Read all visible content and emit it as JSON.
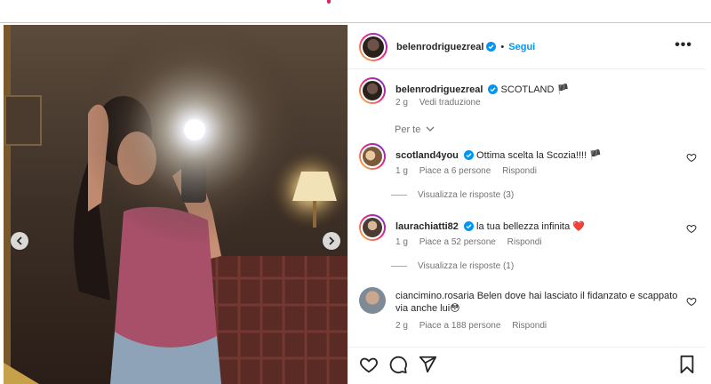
{
  "post": {
    "author": "belenrodriguezreal",
    "follow_label": "Segui",
    "more_label": "•••",
    "caption_text": "SCOTLAND 🏴",
    "caption_time": "2 g",
    "translate_label": "Vedi traduzione",
    "sort_label": "Per te"
  },
  "comments": [
    {
      "username": "scotland4you",
      "text": "Ottima scelta la Scozia!!!! 🏴",
      "time": "1 g",
      "likes": "Piace a 6 persone",
      "reply": "Rispondi",
      "view_replies": "Visualizza le risposte (3)",
      "verified": true
    },
    {
      "username": "laurachiatti82",
      "text": "la tua bellezza infinita ❤️",
      "time": "1 g",
      "likes": "Piace a 52 persone",
      "reply": "Rispondi",
      "view_replies": "Visualizza le risposte (1)",
      "verified": true
    },
    {
      "username": "ciancimino.rosaria",
      "text": "Belen dove hai lasciato il fidanzato e scappato via anche lui😳",
      "time": "2 g",
      "likes": "Piace a 188 persone",
      "reply": "Rispondi",
      "verified": false
    }
  ],
  "icons": {
    "like": "heart-icon",
    "comment": "comment-icon",
    "share": "share-icon",
    "save": "bookmark-icon",
    "prev": "chevron-left-icon",
    "next": "chevron-right-icon",
    "verified": "verified-badge-icon"
  },
  "colors": {
    "accent": "#0095f6",
    "verified": "#0095f6",
    "heart_red": "#ed4956",
    "text": "#262626",
    "secondary_text": "#737373"
  }
}
